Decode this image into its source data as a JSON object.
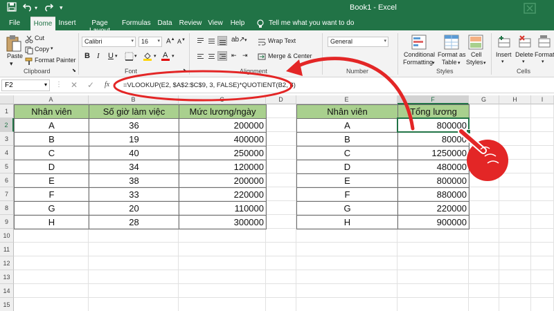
{
  "window": {
    "title": "Book1  -  Excel",
    "quick_access": [
      "save-icon",
      "undo-icon",
      "redo-icon",
      "customize-icon"
    ]
  },
  "tabs": [
    {
      "label": "File"
    },
    {
      "label": "Home"
    },
    {
      "label": "Insert"
    },
    {
      "label": "Page Layout"
    },
    {
      "label": "Formulas"
    },
    {
      "label": "Data"
    },
    {
      "label": "Review"
    },
    {
      "label": "View"
    },
    {
      "label": "Help"
    }
  ],
  "tell_me": "Tell me what you want to do",
  "ribbon": {
    "clipboard": {
      "paste": "Paste",
      "cut": "Cut",
      "copy": "Copy",
      "format_painter": "Format Painter",
      "label": "Clipboard"
    },
    "font": {
      "name": "Calibri",
      "size": "16",
      "bold": "B",
      "italic": "I",
      "underline": "U",
      "label": "Font"
    },
    "alignment": {
      "wrap_text": "Wrap Text",
      "merge_center": "Merge & Center",
      "label": "Alignment"
    },
    "number": {
      "format": "General",
      "label": "Number"
    },
    "styles": {
      "conditional": "Conditional",
      "formatting": "Formatting",
      "format_as": "Format as",
      "table": "Table",
      "cell": "Cell",
      "cell_styles": "Styles",
      "label": "Styles"
    },
    "cells": {
      "insert": "Insert",
      "delete": "Delete",
      "format": "Format",
      "label": "Cells"
    }
  },
  "formula_bar": {
    "name_box": "F2",
    "fx": "fx",
    "formula": "=VLOOKUP(E2, $A$2:$C$9, 3, FALSE)*QUOTIENT(B2, 8)"
  },
  "columns": [
    "A",
    "B",
    "C",
    "D",
    "E",
    "F",
    "G",
    "H",
    "I"
  ],
  "rows": [
    "1",
    "2",
    "3",
    "4",
    "5",
    "6",
    "7",
    "8",
    "9",
    "10",
    "11",
    "12",
    "13",
    "14",
    "15"
  ],
  "table1": {
    "headers": [
      "Nhân viên",
      "Số giờ làm việc",
      "Mức lương/ngày"
    ],
    "rows": [
      [
        "A",
        "36",
        "200000"
      ],
      [
        "B",
        "19",
        "400000"
      ],
      [
        "C",
        "40",
        "250000"
      ],
      [
        "D",
        "34",
        "120000"
      ],
      [
        "E",
        "38",
        "200000"
      ],
      [
        "F",
        "33",
        "220000"
      ],
      [
        "G",
        "20",
        "110000"
      ],
      [
        "H",
        "28",
        "300000"
      ]
    ]
  },
  "table2": {
    "headers": [
      "Nhân viên",
      "Tổng lương"
    ],
    "rows": [
      [
        "A",
        "800000"
      ],
      [
        "B",
        "80000"
      ],
      [
        "C",
        "1250000"
      ],
      [
        "D",
        "480000"
      ],
      [
        "E",
        "800000"
      ],
      [
        "F",
        "880000"
      ],
      [
        "G",
        "220000"
      ],
      [
        "H",
        "900000"
      ]
    ]
  },
  "annotation": {
    "color": "#e32626"
  }
}
